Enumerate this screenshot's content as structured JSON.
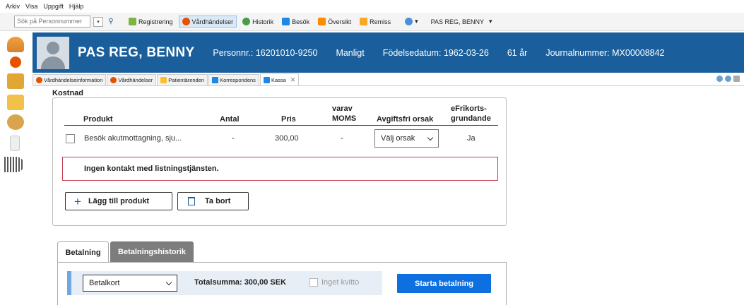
{
  "menu": [
    "Arkiv",
    "Visa",
    "Uppgift",
    "Hjälp"
  ],
  "toolbar": {
    "search_placeholder": "Sök på Personnummer",
    "items": [
      {
        "label": "Registrering",
        "icon": "registration-icon",
        "color": "#7cb342"
      },
      {
        "label": "Vårdhändelser",
        "icon": "care-events-icon",
        "color": "#e65100"
      },
      {
        "label": "Historik",
        "icon": "history-icon",
        "color": "#43a047"
      },
      {
        "label": "Besök",
        "icon": "visit-icon",
        "color": "#1e88e5"
      },
      {
        "label": "Översikt",
        "icon": "overview-icon",
        "color": "#fb8c00"
      },
      {
        "label": "Remiss",
        "icon": "referral-icon",
        "color": "#f9a825"
      }
    ],
    "patient_selector": "PAS REG, BENNY"
  },
  "header": {
    "name": "PAS REG, BENNY",
    "personnr": "Personnr.: 16201010-9250",
    "gender": "Manligt",
    "birthdate": "Födelsedatum: 1962-03-26",
    "age": "61 år",
    "journal": "Journalnummer: MX00008842",
    "bg_color": "#1a5f9c"
  },
  "tabs": [
    {
      "label": "Vårdhändelseinformation",
      "color": "#e65100"
    },
    {
      "label": "Vårdhändelser",
      "color": "#e65100"
    },
    {
      "label": "Patientärenden",
      "color": "#fbc02d"
    },
    {
      "label": "Korrespondens",
      "color": "#1e88e5"
    },
    {
      "label": "Kassa",
      "color": "#1e88e5"
    }
  ],
  "kostnad": {
    "title": "Kostnad",
    "headers": {
      "produkt": "Produkt",
      "antal": "Antal",
      "pris": "Pris",
      "moms_1": "varav",
      "moms_2": "MOMS",
      "avgiftsfri": "Avgiftsfri orsak",
      "efrikort_1": "eFrikorts-",
      "efrikort_2": "grundande"
    },
    "row": {
      "produkt": "Besök akutmottagning, sju...",
      "antal": "-",
      "pris": "300,00",
      "moms": "-",
      "orsak": "Välj orsak",
      "efrikort": "Ja"
    },
    "warning": "Ingen kontakt med listningstjänsten.",
    "add_button": "Lägg till produkt",
    "remove_button": "Ta bort"
  },
  "payment": {
    "tabs": [
      "Betalning",
      "Betalningshistorik"
    ],
    "method": "Betalkort",
    "total": "Totalsumma: 300,00 SEK",
    "no_receipt": "Inget kvitto",
    "start_button": "Starta betalning",
    "accent": "#0d6fe0"
  }
}
